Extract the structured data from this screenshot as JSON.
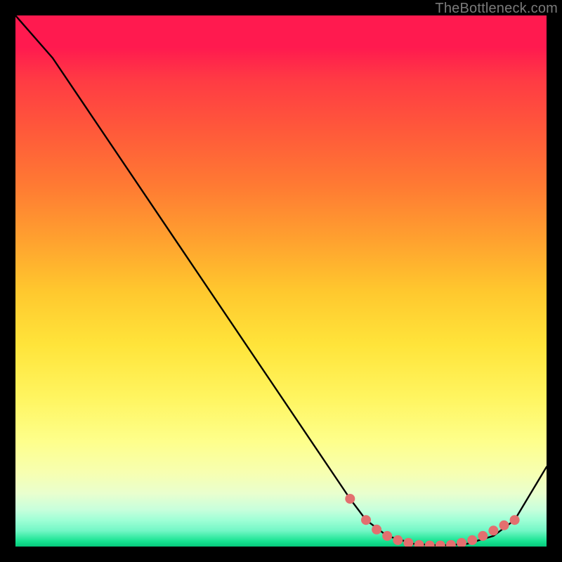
{
  "watermark": "TheBottleneck.com",
  "chart_data": {
    "type": "line",
    "title": "",
    "xlabel": "",
    "ylabel": "",
    "xlim": [
      0,
      100
    ],
    "ylim": [
      0,
      100
    ],
    "grid": false,
    "legend": false,
    "background": "rainbow-gradient-red-to-green",
    "series": [
      {
        "name": "curve",
        "x": [
          0,
          7,
          63,
          66,
          70,
          75,
          80,
          85,
          90,
          94,
          100
        ],
        "y": [
          100,
          92,
          9,
          5,
          2,
          0.5,
          0.2,
          0.5,
          2,
          5,
          15
        ],
        "color": "#000000"
      }
    ],
    "markers": {
      "name": "highlight-points",
      "color": "#e36f6f",
      "radius": 7,
      "x": [
        63,
        66,
        68,
        70,
        72,
        74,
        76,
        78,
        80,
        82,
        84,
        86,
        88,
        90,
        92,
        94
      ],
      "y": [
        9,
        5,
        3.2,
        2,
        1.2,
        0.7,
        0.3,
        0.2,
        0.2,
        0.3,
        0.7,
        1.2,
        2,
        3,
        4,
        5
      ]
    }
  }
}
